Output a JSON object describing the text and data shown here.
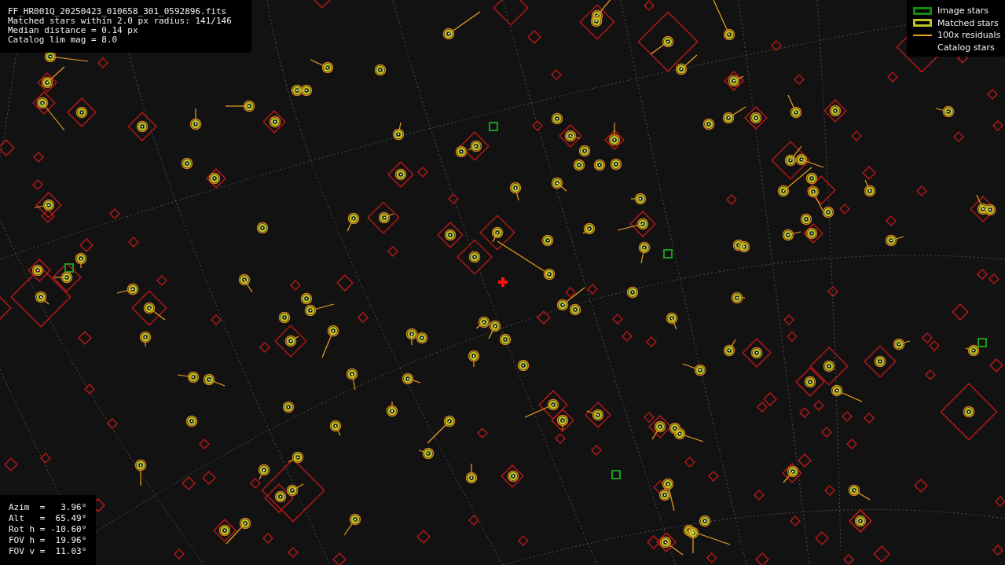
{
  "info_lines": [
    "FF_HR001Q_20250423_010658_301_0592896.fits",
    "Matched stars within 2.0 px radius: 141/146",
    "Median distance = 0.14 px",
    "Catalog lim mag = 8.0"
  ],
  "legend": [
    {
      "kind": "image",
      "label": "Image stars"
    },
    {
      "kind": "matched",
      "label": "Matched stars"
    },
    {
      "kind": "residual",
      "label": "100x residuals"
    },
    {
      "kind": "catalog",
      "label": "Catalog stars"
    }
  ],
  "pointing_lines": [
    "Azim  =   3.96°",
    "Alt   =  65.49°",
    "Rot h = -10.60°",
    "FOV h =  19.96°",
    "FOV v =  11.03°"
  ]
}
